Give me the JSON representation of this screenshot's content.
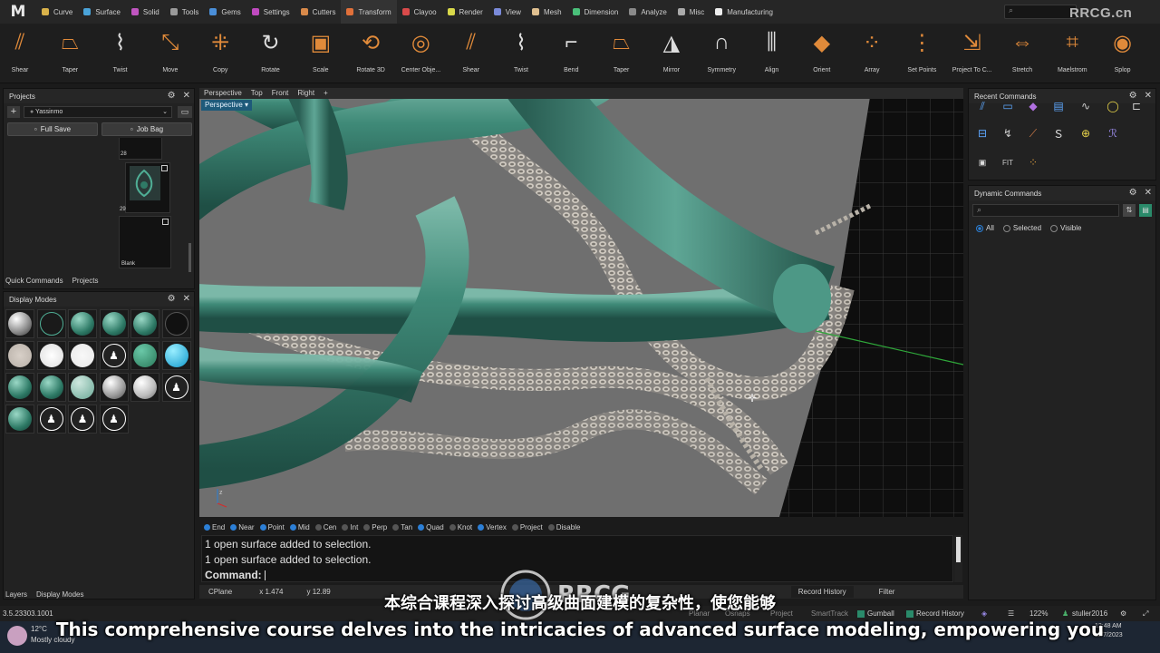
{
  "app": {
    "logo": "M"
  },
  "menu_tabs": [
    {
      "label": "Curve",
      "color": "#d9b24a"
    },
    {
      "label": "Surface",
      "color": "#4aa3d9"
    },
    {
      "label": "Solid",
      "color": "#c055c0"
    },
    {
      "label": "Tools",
      "color": "#9a9a9a"
    },
    {
      "label": "Gems",
      "color": "#4a8fd9"
    },
    {
      "label": "Settings",
      "color": "#c04ac0"
    },
    {
      "label": "Cutters",
      "color": "#d98a4a"
    },
    {
      "label": "Transform",
      "color": "#e0703a"
    },
    {
      "label": "Clayoo",
      "color": "#d94a4a"
    },
    {
      "label": "Render",
      "color": "#d9d94a"
    },
    {
      "label": "View",
      "color": "#7a8ad9"
    },
    {
      "label": "Mesh",
      "color": "#e0c090"
    },
    {
      "label": "Dimension",
      "color": "#4ac07a"
    },
    {
      "label": "Analyze",
      "color": "#8a8a8a"
    },
    {
      "label": "Misc",
      "color": "#aaaaaa"
    },
    {
      "label": "Manufacturing",
      "color": "#eeeeee"
    }
  ],
  "active_tab": "Transform",
  "top_search": {
    "placeholder": "⌕"
  },
  "watermark_top": "RRCG.cn",
  "tools": [
    {
      "label": "Shear",
      "icon": "shear-icon"
    },
    {
      "label": "Taper",
      "icon": "taper-icon"
    },
    {
      "label": "Twist",
      "icon": "twist-icon"
    },
    {
      "label": "Move",
      "icon": "move-icon"
    },
    {
      "label": "Copy",
      "icon": "copy-icon"
    },
    {
      "label": "Rotate",
      "icon": "rotate-icon"
    },
    {
      "label": "Scale",
      "icon": "scale-icon"
    },
    {
      "label": "Rotate 3D",
      "icon": "rotate3d-icon"
    },
    {
      "label": "Center Obje...",
      "icon": "center-object-icon"
    },
    {
      "label": "Shear",
      "icon": "shear-icon"
    },
    {
      "label": "Twist",
      "icon": "twist-icon"
    },
    {
      "label": "Bend",
      "icon": "bend-icon"
    },
    {
      "label": "Taper",
      "icon": "taper-icon"
    },
    {
      "label": "Mirror",
      "icon": "mirror-icon"
    },
    {
      "label": "Symmetry",
      "icon": "symmetry-icon"
    },
    {
      "label": "Align",
      "icon": "align-icon"
    },
    {
      "label": "Orient",
      "icon": "orient-icon"
    },
    {
      "label": "Array",
      "icon": "array-icon"
    },
    {
      "label": "Set Points",
      "icon": "set-points-icon"
    },
    {
      "label": "Project To C...",
      "icon": "project-icon"
    },
    {
      "label": "Stretch",
      "icon": "stretch-icon"
    },
    {
      "label": "Maelstrom",
      "icon": "maelstrom-icon"
    },
    {
      "label": "Splop",
      "icon": "splop-icon"
    }
  ],
  "projects_panel": {
    "title": "Projects",
    "project_name": "Yassinmo",
    "full_save": "Full Save",
    "job_bag": "Job Bag",
    "thumbs": [
      {
        "num": "28"
      },
      {
        "num": "29"
      },
      {
        "num": "Blank"
      }
    ],
    "tabs": [
      "Quick Commands",
      "Projects"
    ]
  },
  "display_modes": {
    "title": "Display Modes",
    "bottom_tabs": [
      "Layers",
      "Display Modes"
    ]
  },
  "viewport": {
    "tabs": [
      "Perspective",
      "Top",
      "Front",
      "Right",
      "+"
    ],
    "label": "Perspective"
  },
  "osnaps": [
    {
      "label": "End",
      "on": true
    },
    {
      "label": "Near",
      "on": true
    },
    {
      "label": "Point",
      "on": true
    },
    {
      "label": "Mid",
      "on": true
    },
    {
      "label": "Cen",
      "on": false
    },
    {
      "label": "Int",
      "on": false
    },
    {
      "label": "Perp",
      "on": false
    },
    {
      "label": "Tan",
      "on": false
    },
    {
      "label": "Quad",
      "on": true
    },
    {
      "label": "Knot",
      "on": false
    },
    {
      "label": "Vertex",
      "on": true
    },
    {
      "label": "Project",
      "on": false
    },
    {
      "label": "Disable",
      "on": false
    }
  ],
  "command_history": [
    "1 open surface added to selection.",
    "1 open surface added to selection."
  ],
  "command_prompt": "Command:",
  "status": {
    "cplane": "CPlane",
    "x": "x 1.474",
    "y": "y 12.89",
    "record_history": "Record History",
    "filter": "Filter"
  },
  "recent_commands": {
    "title": "Recent Commands"
  },
  "dynamic_commands": {
    "title": "Dynamic Commands",
    "radios": [
      {
        "label": "All",
        "on": true
      },
      {
        "label": "Selected",
        "on": false
      },
      {
        "label": "Visible",
        "on": false
      }
    ]
  },
  "bottom_status": {
    "version": "3.5.23303.1001",
    "gumball": "Gumball",
    "record_history": "Record History",
    "zoom": "122%",
    "user": "stuller2016",
    "snap_items": [
      "Planar",
      "Osnaps",
      "Project",
      "SmartTrack"
    ]
  },
  "taskbar": {
    "weather_temp": "12°C",
    "weather_desc": "Mostly cloudy",
    "time": "12:48 AM",
    "date": "11/7/2023"
  },
  "subtitles": {
    "cn": "本综合课程深入探讨高级曲面建模的复杂性，使您能够",
    "en": "This comprehensive course delves into the intricacies of advanced surface modeling, empowering you"
  }
}
